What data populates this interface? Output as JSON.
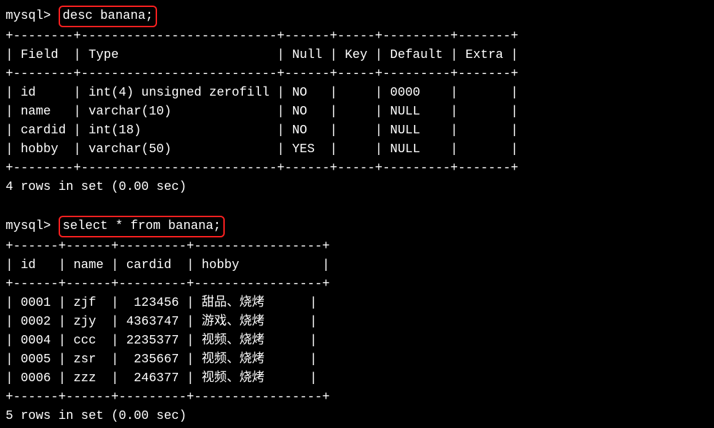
{
  "prompt": "mysql>",
  "query1": "desc banana;",
  "desc_table": {
    "border1": "+--------+--------------------------+------+-----+---------+-------+",
    "headers": "| Field  | Type                     | Null | Key | Default | Extra |",
    "border2": "+--------+--------------------------+------+-----+---------+-------+",
    "rows": [
      "| id     | int(4) unsigned zerofill | NO   |     | 0000    |       |",
      "| name   | varchar(10)              | NO   |     | NULL    |       |",
      "| cardid | int(18)                  | NO   |     | NULL    |       |",
      "| hobby  | varchar(50)              | YES  |     | NULL    |       |"
    ],
    "border3": "+--------+--------------------------+------+-----+---------+-------+",
    "footer": "4 rows in set (0.00 sec)"
  },
  "query2": "select * from banana;",
  "select_table": {
    "border1": "+------+------+---------+-----------------+",
    "headers": "| id   | name | cardid  | hobby           |",
    "border2": "+------+------+---------+-----------------+",
    "rows": [
      "| 0001 | zjf  |  123456 | 甜品、烧烤      |",
      "| 0002 | zjy  | 4363747 | 游戏、烧烤      |",
      "| 0004 | ccc  | 2235377 | 视频、烧烤      |",
      "| 0005 | zsr  |  235667 | 视频、烧烤      |",
      "| 0006 | zzz  |  246377 | 视频、烧烤      |"
    ],
    "border3": "+------+------+---------+-----------------+",
    "footer": "5 rows in set (0.00 sec)"
  }
}
